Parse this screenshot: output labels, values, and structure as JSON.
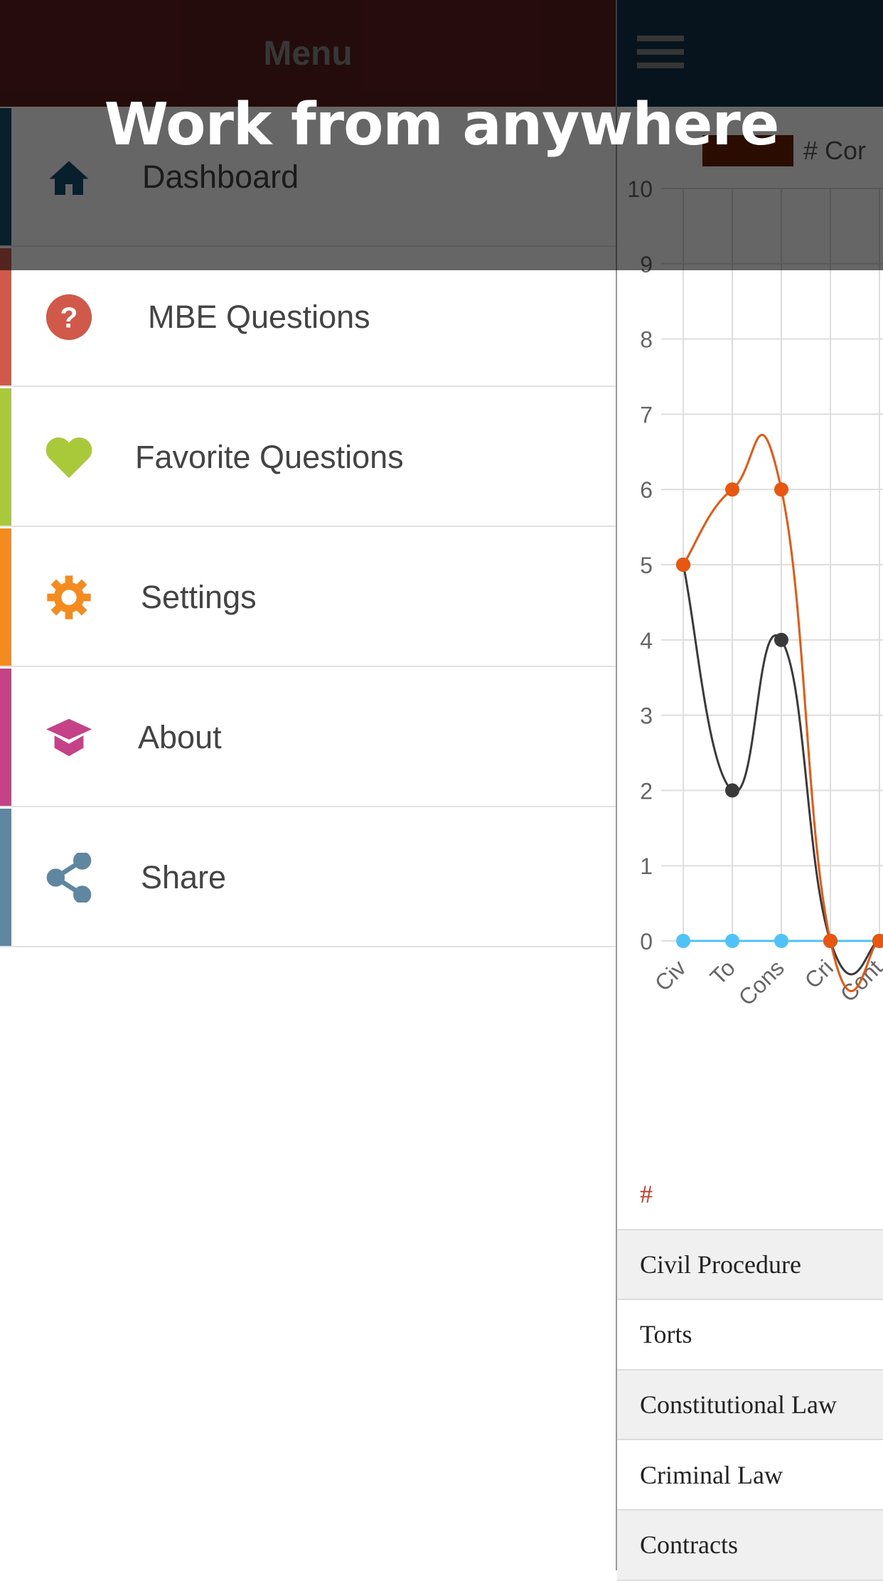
{
  "banner": "Work from anywhere",
  "menu": {
    "title": "Menu",
    "items": [
      {
        "label": "Dashboard",
        "icon": "home-icon",
        "color": "#12506e"
      },
      {
        "label": "MBE Questions",
        "icon": "question-circle-icon",
        "color": "#d0594a"
      },
      {
        "label": "Favorite Questions",
        "icon": "heart-icon",
        "color": "#a9c83a"
      },
      {
        "label": "Settings",
        "icon": "gear-icon",
        "color": "#f58a1f"
      },
      {
        "label": "About",
        "icon": "graduation-cap-icon",
        "color": "#c54289"
      },
      {
        "label": "Share",
        "icon": "share-icon",
        "color": "#5f87a2"
      }
    ]
  },
  "header": {
    "menu_icon": "hamburger-icon",
    "bg": "#12324a"
  },
  "chart_data": {
    "type": "line",
    "categories": [
      "Civ",
      "To",
      "Cons",
      "Cri",
      "Cont"
    ],
    "ylim": [
      0,
      10
    ],
    "yticks": [
      0,
      1,
      2,
      3,
      4,
      5,
      6,
      7,
      8,
      9,
      10
    ],
    "grid": true,
    "legend": {
      "placement": "top",
      "label": "# Cor",
      "color": "#6b2200"
    },
    "series": [
      {
        "values": [
          5,
          6,
          6,
          0,
          0
        ],
        "color": "#e8560f"
      },
      {
        "values": [
          5,
          2,
          4,
          0,
          0
        ],
        "color": "#3a3a3a"
      },
      {
        "values": [
          0,
          0,
          0,
          0,
          0
        ],
        "color": "#4fc3f7"
      }
    ]
  },
  "table": {
    "header": "#",
    "rows": [
      "Civil Procedure",
      "Torts",
      "Constitutional Law",
      "Criminal Law",
      "Contracts"
    ]
  }
}
